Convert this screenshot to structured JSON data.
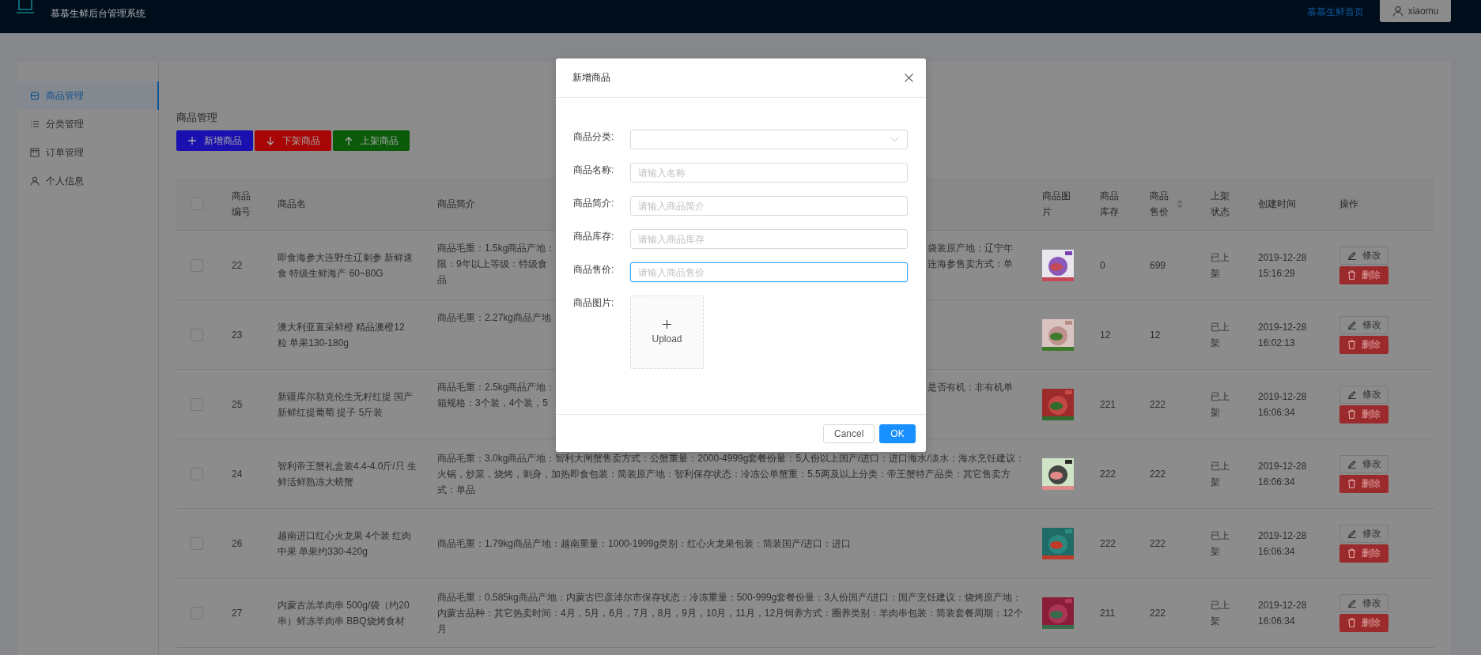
{
  "header": {
    "title": "慕慕生鲜后台管理系统",
    "home_link": "慕慕生鲜首页",
    "user": "xiaomu"
  },
  "sidebar": {
    "items": [
      {
        "label": "商品管理",
        "kind": "goods",
        "selected": true
      },
      {
        "label": "分类管理",
        "kind": "category",
        "selected": false
      },
      {
        "label": "订单管理",
        "kind": "orders",
        "selected": false
      },
      {
        "label": "个人信息",
        "kind": "profile",
        "selected": false
      }
    ]
  },
  "page_title": "商品管理",
  "toolbar": [
    {
      "label": "新增商品",
      "kind": "add",
      "color": "#1a10b0"
    },
    {
      "label": "下架商品",
      "kind": "down",
      "color": "#a80606"
    },
    {
      "label": "上架商品",
      "kind": "up",
      "color": "#0a5a0a"
    }
  ],
  "table": {
    "select_all_checked": false,
    "columns": [
      {
        "label": "商品编号",
        "sortable": false
      },
      {
        "label": "商品名",
        "sortable": false
      },
      {
        "label": "商品简介",
        "sortable": false
      },
      {
        "label": "商品图片",
        "sortable": false
      },
      {
        "label": "商品库存",
        "sortable": false
      },
      {
        "label": "商品售价",
        "sortable": true
      },
      {
        "label": "上架状态",
        "sortable": false
      },
      {
        "label": "创建时间",
        "sortable": false
      },
      {
        "label": "操作",
        "sortable": false
      }
    ],
    "rows": [
      {
        "checked": false,
        "id": "22",
        "name": "即食海参大连野生辽刺参 新鲜速食 特级生鲜海产 60~80G",
        "description": {
          "left": [
            "商品毛重：1.5kg商品产地：",
            "限：9年以上等级：特级食",
            "品"
          ],
          "right": [
            "袋装原产地：辽宁年",
            "连海参售卖方式：单"
          ]
        },
        "image": {
          "kind": "picture"
        },
        "stock": "0",
        "price": "699",
        "status": "已上架",
        "created": "2019-12-28 15:16:29",
        "actions": [
          "修改",
          "删除"
        ]
      },
      {
        "checked": false,
        "id": "23",
        "name": "澳大利亚直采鲜橙 精品澳橙12粒 单果130-180g",
        "description": {
          "left": [
            "商品毛重：2.27kg商品产地"
          ]
        },
        "image": {
          "kind": "picture"
        },
        "stock": "12",
        "price": "12",
        "status": "已上架",
        "created": "2019-12-28 16:02:13",
        "actions": [
          "修改",
          "删除"
        ]
      },
      {
        "checked": false,
        "id": "25",
        "name": "新疆库尔勒克伦生无籽红提 国产新鲜红提葡萄 提子 5斤装",
        "description": {
          "left": [
            "商品毛重：2.5kg商品产地：",
            "箱规格：3个装，4个装，5"
          ],
          "right": [
            "是否有机：非有机单"
          ]
        },
        "image": {
          "kind": "picture"
        },
        "stock": "221",
        "price": "222",
        "status": "已上架",
        "created": "2019-12-28 16:06:34",
        "actions": [
          "修改",
          "删除"
        ]
      },
      {
        "checked": false,
        "id": "24",
        "name": "智利帝王蟹礼盒装4.4-4.0斤/只 生鲜活鲜熟冻大螃蟹",
        "description": "商品毛重：3.0kg商品产地：智利大闸蟹售卖方式：公蟹重量：2000-4999g套餐份量：5人份以上国产/进口：进口海水/淡水：海水烹饪建议：火锅，炒菜，烧烤，刺身，加热即食包装：简装原产地：智利保存状态：冷冻公单蟹重：5.5两及以上分类：帝王蟹特产品类：其它售卖方式：单品",
        "image": {
          "kind": "picture"
        },
        "stock": "222",
        "price": "222",
        "status": "已上架",
        "created": "2019-12-28 16:06:34",
        "actions": [
          "修改",
          "删除"
        ]
      },
      {
        "checked": false,
        "id": "26",
        "name": "越南进口红心火龙果 4个装 红肉中果 单果约330-420g",
        "description": "商品毛重：1.79kg商品产地：越南重量：1000-1999g类别：红心火龙果包装：简装国产/进口：进口",
        "image": {
          "kind": "picture"
        },
        "stock": "222",
        "price": "222",
        "status": "已上架",
        "created": "2019-12-28 16:06:34",
        "actions": [
          "修改",
          "删除"
        ]
      },
      {
        "checked": false,
        "id": "27",
        "name": "内蒙古羔羊肉串 500g/袋（约20串）鲜冻羊肉串 BBQ烧烤食材",
        "description": "商品毛重：0.585kg商品产地：内蒙古巴彦淖尔市保存状态：冷冻重量：500-999g套餐份量：3人份国产/进口：国产烹饪建议：烧烤原产地：内蒙古品种：其它热卖时间：4月，5月，6月，7月，8月，9月，10月，11月，12月饲养方式：圈养类别：羊肉串包装：简装套餐周期：12个月",
        "image": {
          "kind": "picture"
        },
        "stock": "211",
        "price": "222",
        "status": "已上架",
        "created": "2019-12-28 16:06:34",
        "actions": [
          "修改",
          "删除"
        ]
      }
    ]
  },
  "dialog": {
    "title": "新增商品",
    "fields": [
      {
        "label": "商品分类:",
        "kind": "select"
      },
      {
        "label": "商品名称:",
        "kind": "text",
        "placeholder": "请输入名称",
        "focused": false
      },
      {
        "label": "商品简介:",
        "kind": "text",
        "placeholder": "请输入商品简介",
        "focused": false
      },
      {
        "label": "商品库存:",
        "kind": "text",
        "placeholder": "请输入商品库存",
        "focused": false
      },
      {
        "label": "商品售价:",
        "kind": "text",
        "placeholder": "请输入商品售价",
        "focused": true
      },
      {
        "label": "商品图片:",
        "kind": "upload",
        "button": "Upload"
      }
    ],
    "buttons": [
      {
        "label": "Cancel",
        "primary": false
      },
      {
        "label": "OK",
        "primary": true
      }
    ]
  }
}
